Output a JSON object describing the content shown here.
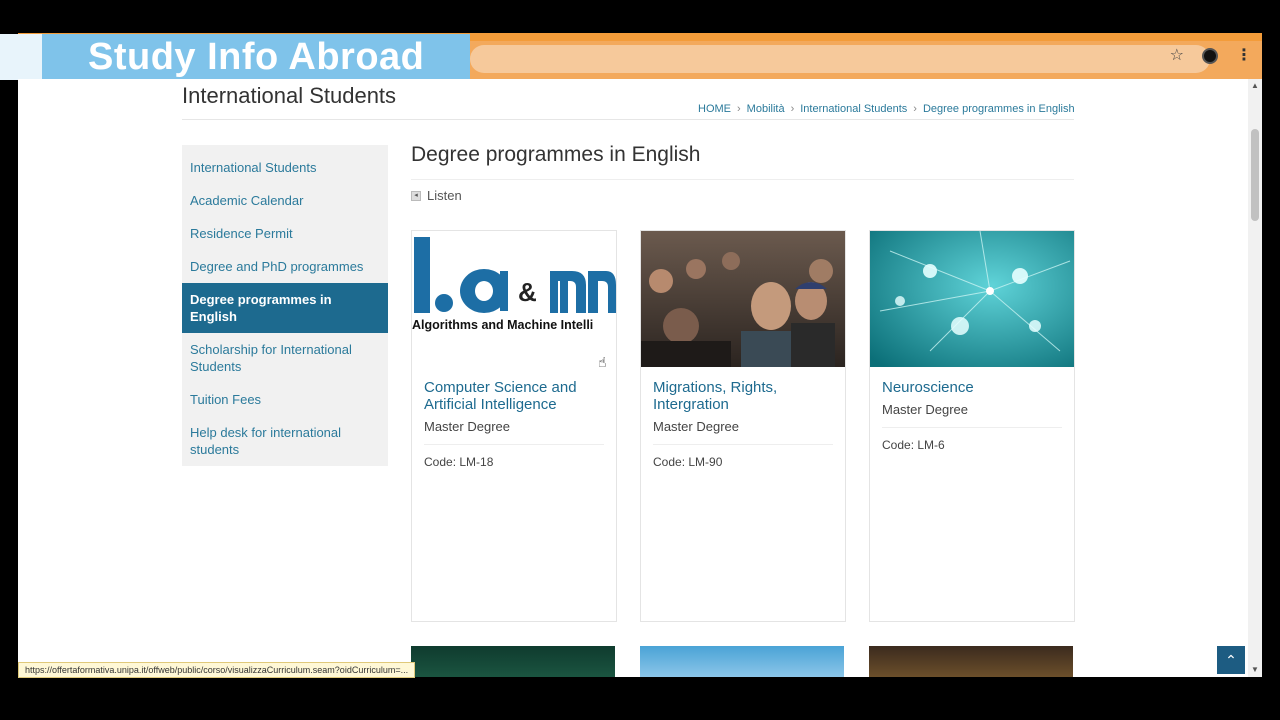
{
  "banner": {
    "title": "Study Info Abroad"
  },
  "browser": {
    "star_icon": "star-icon",
    "profile_icon": "profile-avatar",
    "menu_icon": "kebab-menu-icon"
  },
  "page": {
    "site_title": "International Students",
    "breadcrumb": [
      "HOME",
      "Mobilità",
      "International Students",
      "Degree programmes in English"
    ],
    "sidebar": [
      {
        "label": "International Students",
        "active": false
      },
      {
        "label": "Academic Calendar",
        "active": false
      },
      {
        "label": "Residence Permit",
        "active": false
      },
      {
        "label": "Degree and PhD programmes",
        "active": false
      },
      {
        "label": "Degree programmes in English",
        "active": true
      },
      {
        "label": "Scholarship for International Students",
        "active": false
      },
      {
        "label": "Tuition Fees",
        "active": false
      },
      {
        "label": "Help desk for international students",
        "active": false
      }
    ],
    "main_title": "Degree programmes in English",
    "listen_label": "Listen",
    "cards": [
      {
        "title": "Computer Science and Artificial Intelligence",
        "subtitle": "Master Degree",
        "code": "Code: LM-18",
        "logo_text": "Algorithms and Machine Intelli"
      },
      {
        "title": "Migrations, Rights, Intergration",
        "subtitle": "Master Degree",
        "code": "Code: LM-90"
      },
      {
        "title": "Neuroscience",
        "subtitle": "Master Degree",
        "code": "Code: LM-6"
      }
    ],
    "status_url": "https://offertaformativa.unipa.it/offweb/public/corso/visualizzaCurriculum.seam?oidCurriculum=..."
  },
  "colors": {
    "accent": "#1d6a8f",
    "link": "#2b7a9b",
    "banner": "#7fc3ea",
    "chrome": "#f3a95c"
  }
}
